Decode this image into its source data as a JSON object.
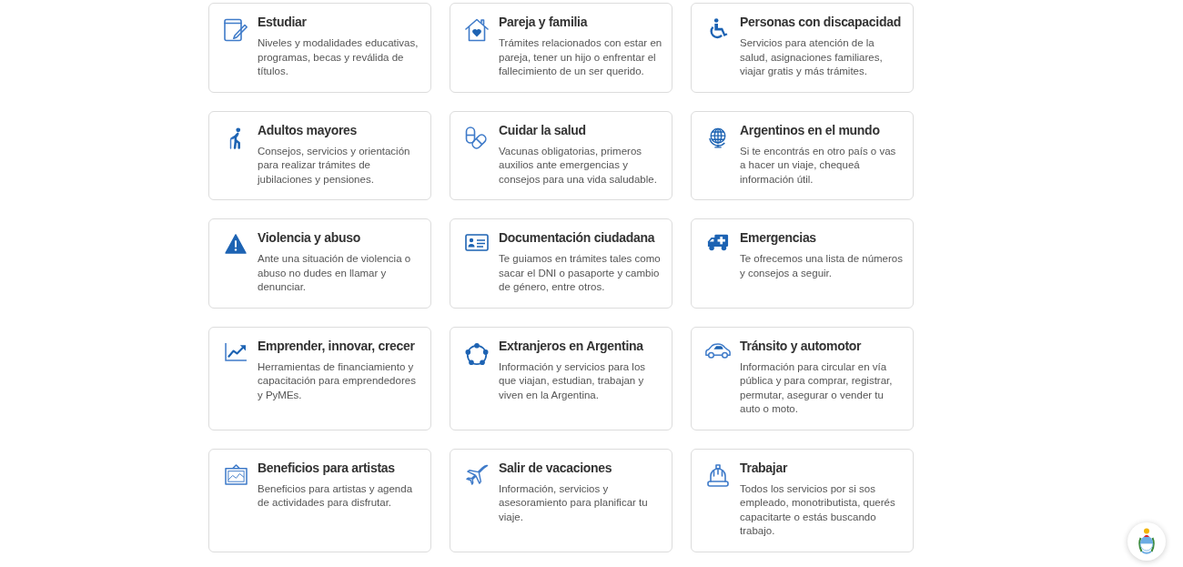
{
  "cards": [
    {
      "title": "Estudiar",
      "description": "Niveles y modalidades educativas, programas, becas y reválida de títulos."
    },
    {
      "title": "Pareja y familia",
      "description": "Trámites relacionados con estar en pareja, tener un hijo o enfrentar el fallecimiento de un ser querido."
    },
    {
      "title": "Personas con discapacidad",
      "description": "Servicios para atención de la salud, asignaciones familiares, viajar gratis y más trámites."
    },
    {
      "title": "Adultos mayores",
      "description": "Consejos, servicios y orientación para realizar trámites de jubilaciones y pensiones."
    },
    {
      "title": "Cuidar la salud",
      "description": "Vacunas obligatorias, primeros auxilios ante emergencias y consejos para una vida saludable."
    },
    {
      "title": "Argentinos en el mundo",
      "description": "Si te encontrás en otro país o vas a hacer un viaje, chequeá información útil."
    },
    {
      "title": "Violencia y abuso",
      "description": "Ante una situación de violencia o abuso no dudes en llamar y denunciar."
    },
    {
      "title": "Documentación ciudadana",
      "description": "Te guiamos en trámites tales como sacar el DNI o pasaporte y cambio de género, entre otros."
    },
    {
      "title": "Emergencias",
      "description": "Te ofrecemos una lista de números y consejos a seguir."
    },
    {
      "title": "Emprender, innovar, crecer",
      "description": "Herramientas de financiamiento y capacitación para emprendedores y PyMEs."
    },
    {
      "title": "Extranjeros en Argentina",
      "description": "Información y servicios para los que viajan, estudian, trabajan y viven en la Argentina."
    },
    {
      "title": "Tránsito y automotor",
      "description": "Información para circular en vía pública y para comprar, registrar, permutar, asegurar o vender tu auto o moto."
    },
    {
      "title": "Beneficios para artistas",
      "description": "Beneficios para artistas y agenda de actividades para disfrutar."
    },
    {
      "title": "Salir de vacaciones",
      "description": "Información, servicios y asesoramiento para planificar tu viaje."
    },
    {
      "title": "Trabajar",
      "description": "Todos los servicios por si sos empleado, monotributista, querés capacitarte o estás buscando trabajo."
    }
  ]
}
